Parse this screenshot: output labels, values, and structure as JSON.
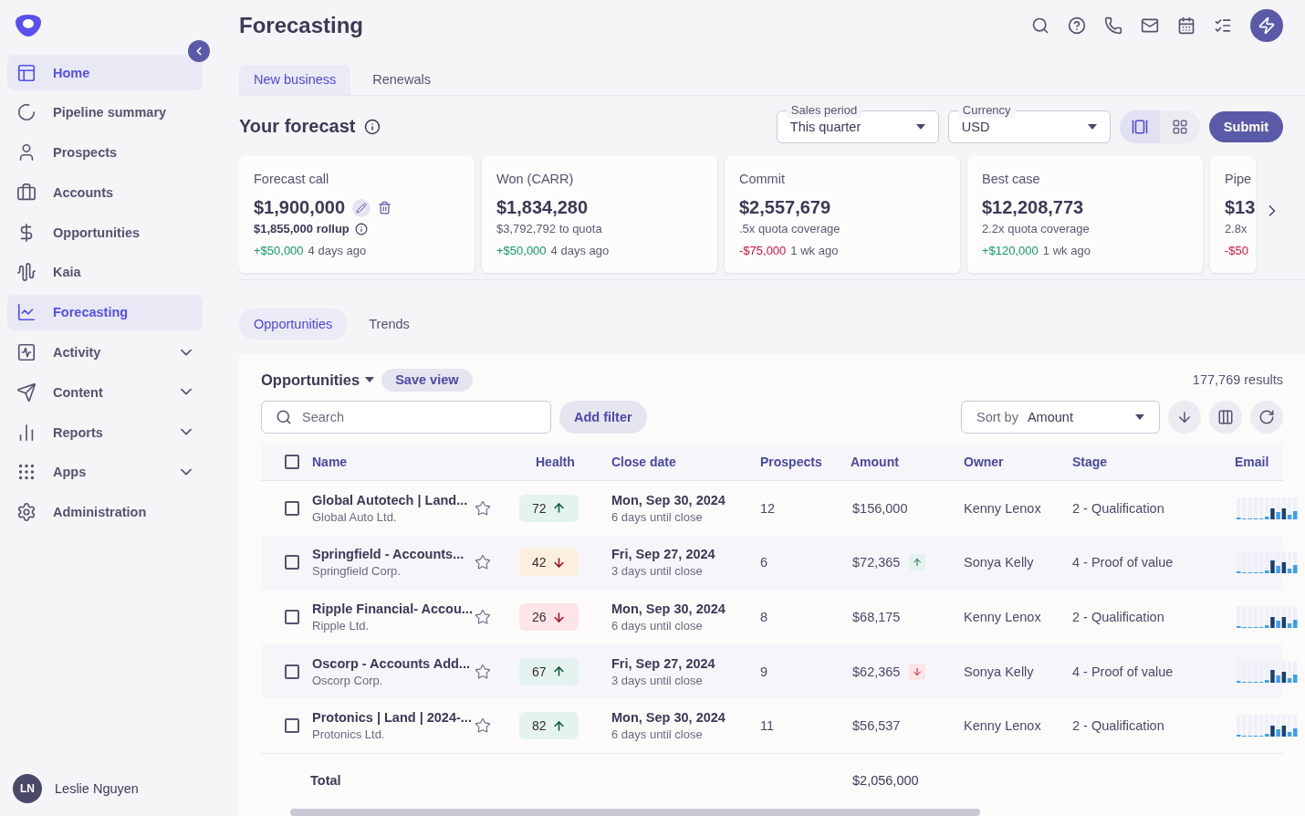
{
  "sidebar": {
    "items": [
      {
        "label": "Home",
        "selected": true,
        "expandable": false
      },
      {
        "label": "Pipeline summary",
        "selected": false,
        "expandable": false
      },
      {
        "label": "Prospects",
        "selected": false,
        "expandable": false
      },
      {
        "label": "Accounts",
        "selected": false,
        "expandable": false
      },
      {
        "label": "Opportunities",
        "selected": false,
        "expandable": false
      },
      {
        "label": "Kaia",
        "selected": false,
        "expandable": false
      },
      {
        "label": "Forecasting",
        "selected": true,
        "expandable": false
      },
      {
        "label": "Activity",
        "selected": false,
        "expandable": true
      },
      {
        "label": "Content",
        "selected": false,
        "expandable": true
      },
      {
        "label": "Reports",
        "selected": false,
        "expandable": true
      },
      {
        "label": "Apps",
        "selected": false,
        "expandable": true
      },
      {
        "label": "Administration",
        "selected": false,
        "expandable": false
      }
    ],
    "user": {
      "initials": "LN",
      "name": "Leslie Nguyen"
    }
  },
  "header": {
    "title": "Forecasting"
  },
  "tabs": [
    {
      "label": "New business",
      "selected": true
    },
    {
      "label": "Renewals",
      "selected": false
    }
  ],
  "forecast": {
    "title": "Your forecast",
    "sales_period": {
      "label": "Sales period",
      "value": "This quarter"
    },
    "currency": {
      "label": "Currency",
      "value": "USD"
    },
    "view_toggle": [
      {
        "kind": "carousel",
        "selected": true
      },
      {
        "kind": "grid",
        "selected": false
      }
    ],
    "submit": "Submit",
    "cards": [
      {
        "title": "Forecast call",
        "value": "$1,900,000",
        "subtitle": "$1,855,000 rollup",
        "editable": true,
        "change": "+$50,000",
        "color": "#0f9a63",
        "ago": "4 days ago"
      },
      {
        "title": "Won (CARR)",
        "value": "$1,834,280",
        "subtitle": "$3,792,792 to quota",
        "editable": false,
        "change": "+$50,000",
        "color": "#0f9a63",
        "ago": "4 days ago"
      },
      {
        "title": "Commit",
        "value": "$2,557,679",
        "subtitle": ".5x quota coverage",
        "editable": false,
        "change": "-$75,000",
        "color": "#d3103b",
        "ago": "1 wk ago"
      },
      {
        "title": "Best case",
        "value": "$12,208,773",
        "subtitle": "2.2x quota coverage",
        "editable": false,
        "change": "+$120,000",
        "color": "#0f9a63",
        "ago": "1 wk ago"
      },
      {
        "title": "Pipe",
        "value": "$13",
        "subtitle": "2.8x",
        "editable": false,
        "change": "-$50",
        "color": "#d3103b"
      }
    ]
  },
  "sub_tabs": [
    {
      "label": "Opportunities",
      "selected": true
    },
    {
      "label": "Trends",
      "selected": false
    }
  ],
  "table": {
    "view": "Opportunities",
    "save_view": "Save view",
    "results": "177,769 results",
    "search": {
      "placeholder": "Search"
    },
    "add_filter": "Add filter",
    "sort": {
      "label": "Sort by",
      "value": "Amount"
    },
    "select_all": {
      "checked": false
    },
    "columns": [
      "Name",
      "Health",
      "Close date",
      "Prospects",
      "Amount",
      "Owner",
      "Stage",
      "Email"
    ],
    "rows": [
      {
        "checked": false,
        "name": "Global Autotech | Land...",
        "account": "Global Auto Ltd.",
        "health": {
          "value": "72",
          "kind": "up",
          "color": "#e4f3ef"
        },
        "date": "Mon, Sep 30, 2024",
        "until": "6 days until close",
        "prospects": "12",
        "amount": "$156,000",
        "owner": "Kenny Lenox",
        "stage": "2 - Qualification"
      },
      {
        "checked": false,
        "name": "Springfield - Accounts...",
        "account": "Springfield Corp.",
        "health": {
          "value": "42",
          "kind": "down",
          "color": "#fcefdd"
        },
        "date": "Fri, Sep 27, 2024",
        "until": "3 days until close",
        "prospects": "6",
        "amount": "$72,365",
        "amount_change": {
          "kind": "up"
        },
        "owner": "Sonya Kelly",
        "stage": "4 - Proof of value"
      },
      {
        "checked": false,
        "name": "Ripple Financial- Accou...",
        "account": "Ripple Ltd.",
        "health": {
          "value": "26",
          "kind": "down",
          "color": "#fde4e6"
        },
        "date": "Mon, Sep 30, 2024",
        "until": "6 days until close",
        "prospects": "8",
        "amount": "$68,175",
        "owner": "Kenny Lenox",
        "stage": "2 - Qualification"
      },
      {
        "checked": false,
        "name": "Oscorp - Accounts Add...",
        "account": "Oscorp Corp.",
        "health": {
          "value": "67",
          "kind": "up",
          "color": "#e4f3ef"
        },
        "date": "Fri, Sep 27, 2024",
        "until": "3 days until close",
        "prospects": "9",
        "amount": "$62,365",
        "amount_change": {
          "kind": "down"
        },
        "owner": "Sonya Kelly",
        "stage": "4 - Proof of value"
      },
      {
        "checked": false,
        "name": "Protonics | Land | 2024-...",
        "account": "Protonics Ltd.",
        "health": {
          "value": "82",
          "kind": "up",
          "color": "#e4f3ef"
        },
        "date": "Mon, Sep 30, 2024",
        "until": "6 days until close",
        "prospects": "11",
        "amount": "$56,537",
        "owner": "Kenny Lenox",
        "stage": "2 - Qualification"
      }
    ],
    "total": {
      "label": "Total",
      "amount": "$2,056,000"
    }
  }
}
